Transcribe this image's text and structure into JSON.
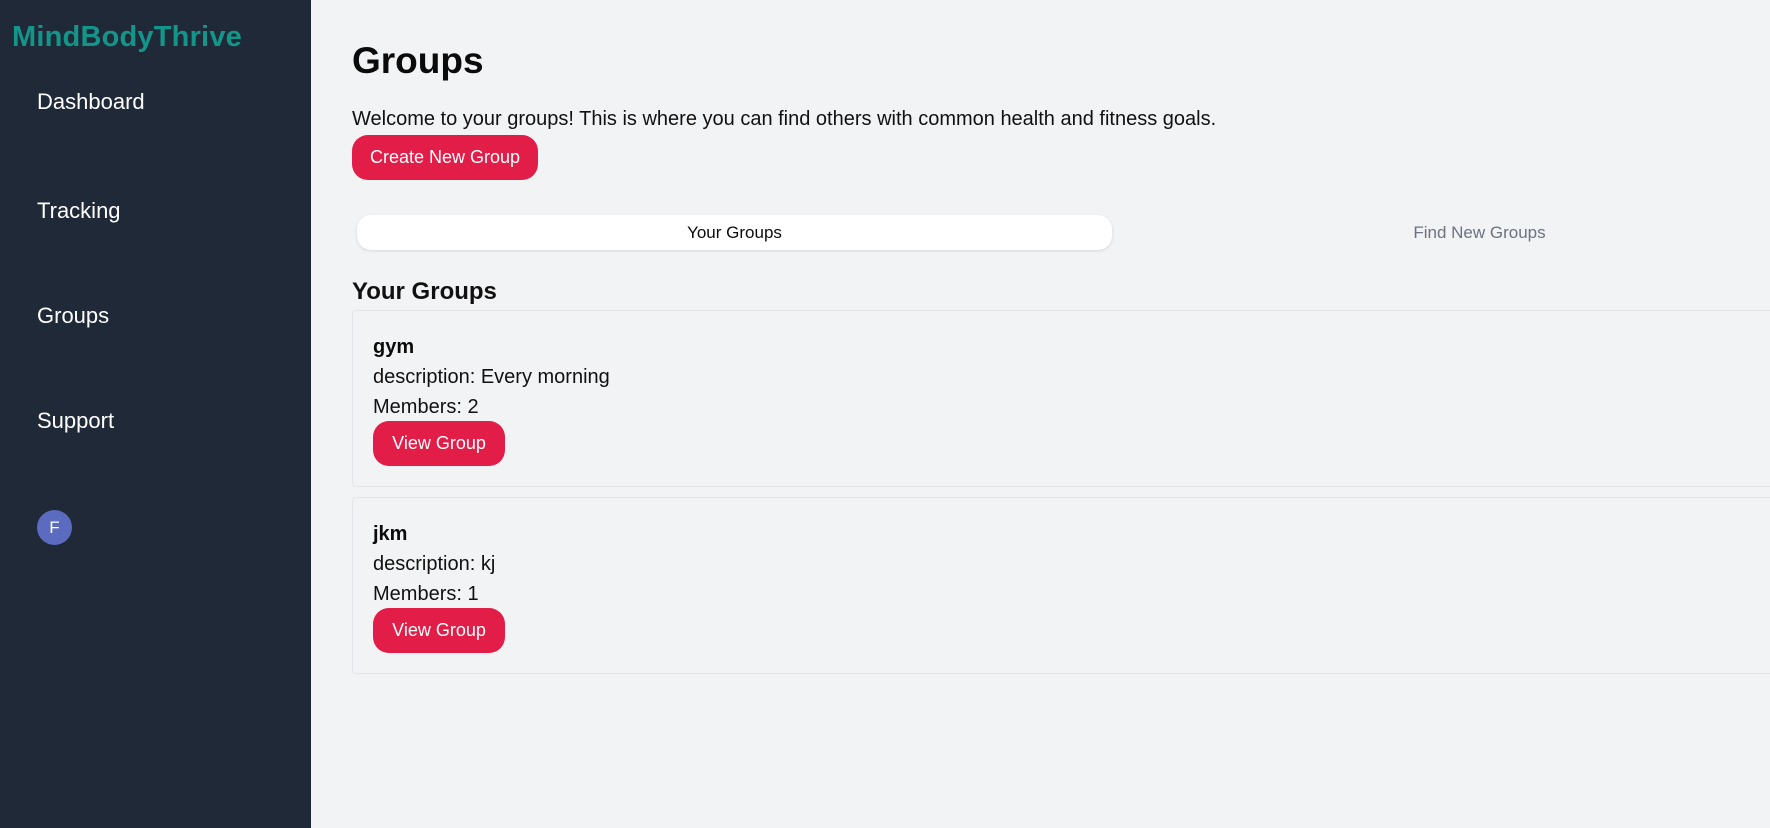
{
  "brand": {
    "name": "MindBodyThrive",
    "color": "#14958a"
  },
  "sidebar": {
    "items": [
      {
        "label": "Dashboard"
      },
      {
        "label": "Tracking"
      },
      {
        "label": "Groups"
      },
      {
        "label": "Support"
      }
    ],
    "avatar_initial": "F"
  },
  "main": {
    "title": "Groups",
    "welcome_text": "Welcome to your groups! This is where you can find others with common health and fitness goals.",
    "create_button_label": "Create New Group",
    "tabs": [
      {
        "label": "Your Groups",
        "active": true
      },
      {
        "label": "Find New Groups",
        "active": false
      }
    ],
    "section_title": "Your Groups",
    "groups": [
      {
        "name": "gym",
        "description": "description: Every morning",
        "members": "Members: 2",
        "button_label": "View Group"
      },
      {
        "name": "jkm",
        "description": "description: kj",
        "members": "Members: 1",
        "button_label": "View Group"
      }
    ]
  },
  "colors": {
    "sidebar_bg": "#1f2937",
    "accent_button": "#e11d48",
    "avatar_bg": "#5b6bc0",
    "page_bg": "#f2f3f5"
  }
}
